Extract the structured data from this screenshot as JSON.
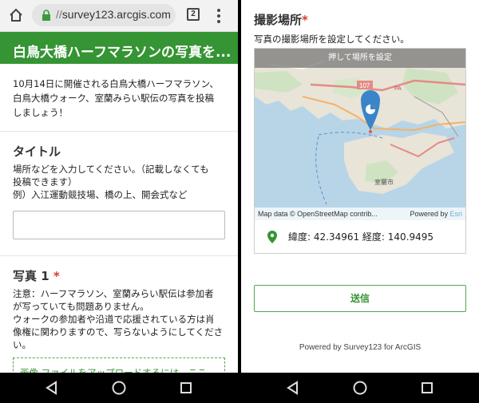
{
  "browser": {
    "url_scheme": "//",
    "url_host": "survey123.arcgis.com",
    "tab_count": "2"
  },
  "survey": {
    "banner_title": "白鳥大橋ハーフマラソンの写真を...",
    "intro_lines": [
      "10月14日に開催される白鳥大橋ハーフマラソン、",
      "白鳥大橋ウォーク、室蘭みらい駅伝の写真を投稿",
      "しましょう！"
    ],
    "title_question": {
      "label": "タイトル",
      "desc_lines": [
        "場所などを入力してください。（記載しなくても",
        "投稿できます）",
        "例）入江運動競技場、橋の上、開会式など"
      ]
    },
    "photo_question": {
      "label": "写真 1",
      "required_mark": "*",
      "desc_lines": [
        "注意：ハーフマラソン、室蘭みらい駅伝は参加者",
        "が写っていても問題ありません。",
        "ウォークの参加者や沿道で応援されている方は肖",
        "像権に関わりますので、写らないようにしてくださ",
        "い。"
      ],
      "upload_label": "画像 ファイルをアップロードするには、ここ..."
    },
    "location_question": {
      "label": "撮影場所",
      "required_mark": "*",
      "desc": "写真の撮影場所を設定してください。",
      "map_banner": "押して場所を設定",
      "attribution": "Map data © OpenStreetMap contrib...",
      "powered_prefix": "Powered by",
      "powered_esri": "Esri",
      "route_label": "107",
      "route_label2": "PA",
      "city_label": "室蘭市",
      "coords": "緯度: 42.34961  経度: 140.9495"
    },
    "submit_label": "送信",
    "footer": "Powered by Survey123 for ArcGIS"
  },
  "colors": {
    "brand_green": "#359433",
    "required_red": "#d63c2e",
    "water": "#b7d5e6",
    "pin_blue": "#3a85c8"
  }
}
